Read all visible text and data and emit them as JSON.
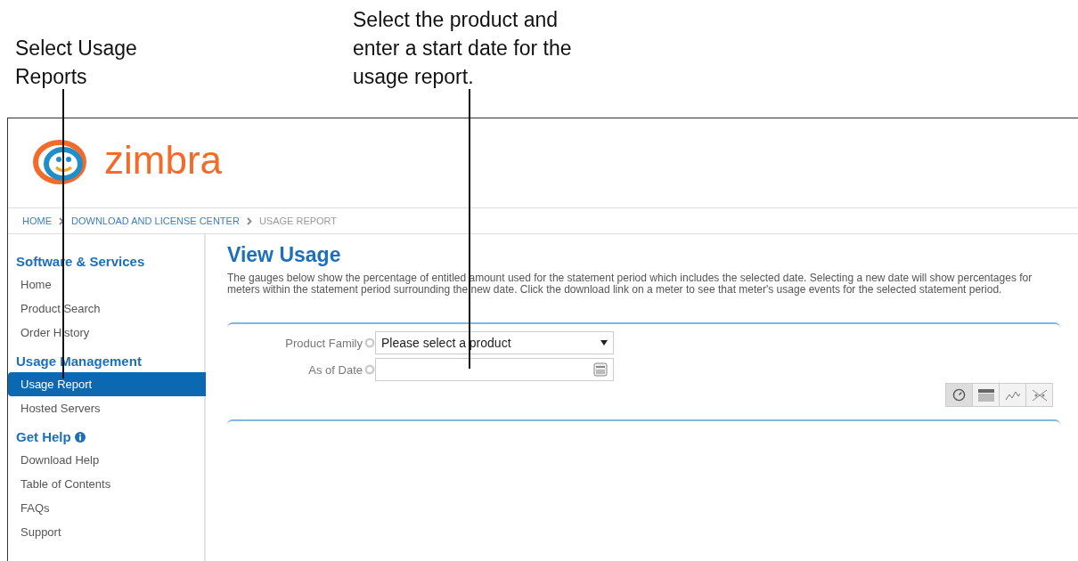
{
  "callouts": [
    {
      "text": "Select Usage Reports"
    },
    {
      "text": "Select the product and enter a start date for the usage report."
    }
  ],
  "logo": {
    "text": "zimbra"
  },
  "breadcrumb": [
    "HOME",
    "DOWNLOAD AND LICENSE CENTER",
    "USAGE REPORT"
  ],
  "sidebar": {
    "sections": [
      {
        "title": "Software & Services",
        "info": false,
        "items": [
          {
            "label": "Home",
            "selected": false
          },
          {
            "label": "Product Search",
            "selected": false
          },
          {
            "label": "Order History",
            "selected": false
          }
        ]
      },
      {
        "title": "Usage Management",
        "info": false,
        "items": [
          {
            "label": "Usage Report",
            "selected": true
          },
          {
            "label": "Hosted Servers",
            "selected": false
          }
        ]
      },
      {
        "title": "Get Help",
        "info": true,
        "items": [
          {
            "label": "Download Help",
            "selected": false
          },
          {
            "label": "Table of Contents",
            "selected": false
          },
          {
            "label": "FAQs",
            "selected": false
          },
          {
            "label": "Support",
            "selected": false
          }
        ]
      }
    ]
  },
  "main": {
    "title": "View Usage",
    "description": "The gauges below show the percentage of entitled amount used for the statement period which includes the selected date. Selecting a new date will show percentages for meters within the statement period surrounding the new date. Click the download link on a meter to see that meter's usage events for the selected statement period.",
    "fields": [
      {
        "label": "Product Family",
        "kind": "select",
        "value": "Please select a product"
      },
      {
        "label": "As of Date",
        "kind": "date"
      }
    ],
    "view_modes": [
      {
        "kind": "gauge",
        "selected": true
      },
      {
        "kind": "table",
        "selected": false
      },
      {
        "kind": "line",
        "selected": false
      },
      {
        "kind": "scatter",
        "selected": false
      }
    ]
  }
}
